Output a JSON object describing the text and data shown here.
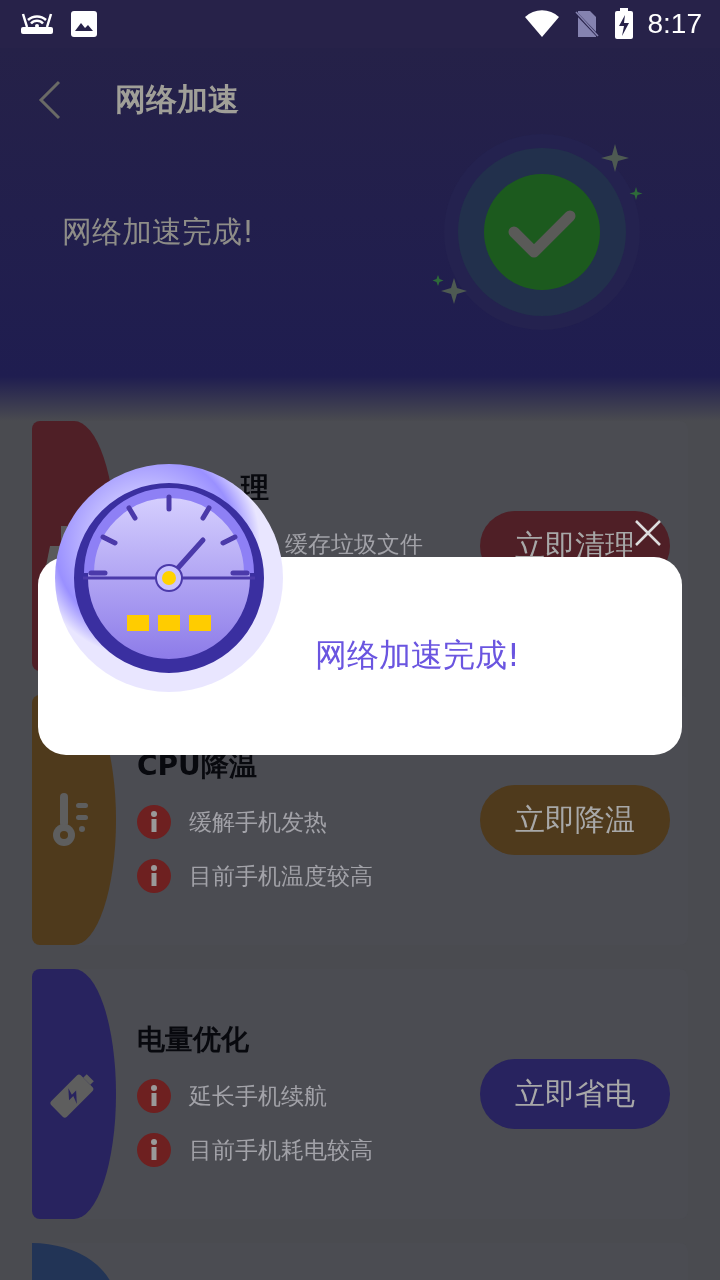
{
  "status_bar": {
    "time": "8:17"
  },
  "header": {
    "title": "网络加速"
  },
  "hero": {
    "message": "网络加速完成!"
  },
  "cards": [
    {
      "kind": "clean",
      "covered": true,
      "color": "#4f1f26",
      "title": "理",
      "lines": [
        "缓存垃圾文件"
      ],
      "button": "立即清理"
    },
    {
      "kind": "cool",
      "covered": false,
      "color": "#4f3a1c",
      "title": "CPU降温",
      "lines": [
        "缓解手机发热",
        "目前手机温度较高"
      ],
      "button": "立即降温"
    },
    {
      "kind": "battery",
      "covered": false,
      "color": "#28235f",
      "title": "电量优化",
      "lines": [
        "延长手机续航",
        "目前手机耗电较高"
      ],
      "button": "立即省电"
    }
  ],
  "dialog": {
    "message": "网络加速完成!"
  }
}
